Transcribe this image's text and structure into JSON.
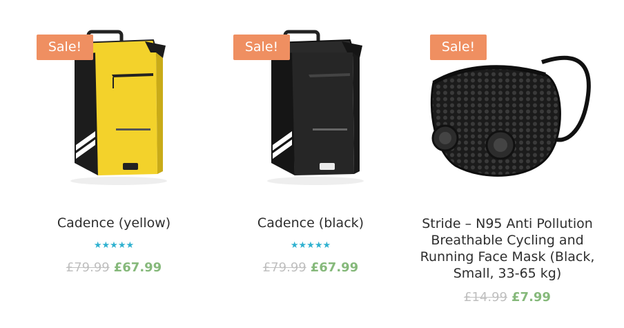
{
  "products": [
    {
      "badge": "Sale!",
      "title": "Cadence (yellow)",
      "rating_stars": "★★★★★",
      "rating": 5,
      "old_price": "£79.99",
      "new_price": "£67.99",
      "colors": {
        "body": "#f3d22b",
        "side": "#1c1c1c"
      },
      "icon": "pannier-bag-yellow"
    },
    {
      "badge": "Sale!",
      "title": "Cadence (black)",
      "rating_stars": "★★★★★",
      "rating": 5,
      "old_price": "£79.99",
      "new_price": "£67.99",
      "colors": {
        "body": "#262626",
        "side": "#151515"
      },
      "icon": "pannier-bag-black"
    },
    {
      "badge": "Sale!",
      "title": "Stride – N95 Anti Pollution Breathable Cycling and Running Face Mask (Black, Small, 33-65 kg)",
      "old_price": "£14.99",
      "new_price": "£7.99",
      "icon": "face-mask-black"
    }
  ],
  "colors": {
    "sale_badge": "#ef8f61",
    "stars": "#2fb1d0",
    "new_price": "#86b97b",
    "old_price": "#bfbfbf"
  }
}
